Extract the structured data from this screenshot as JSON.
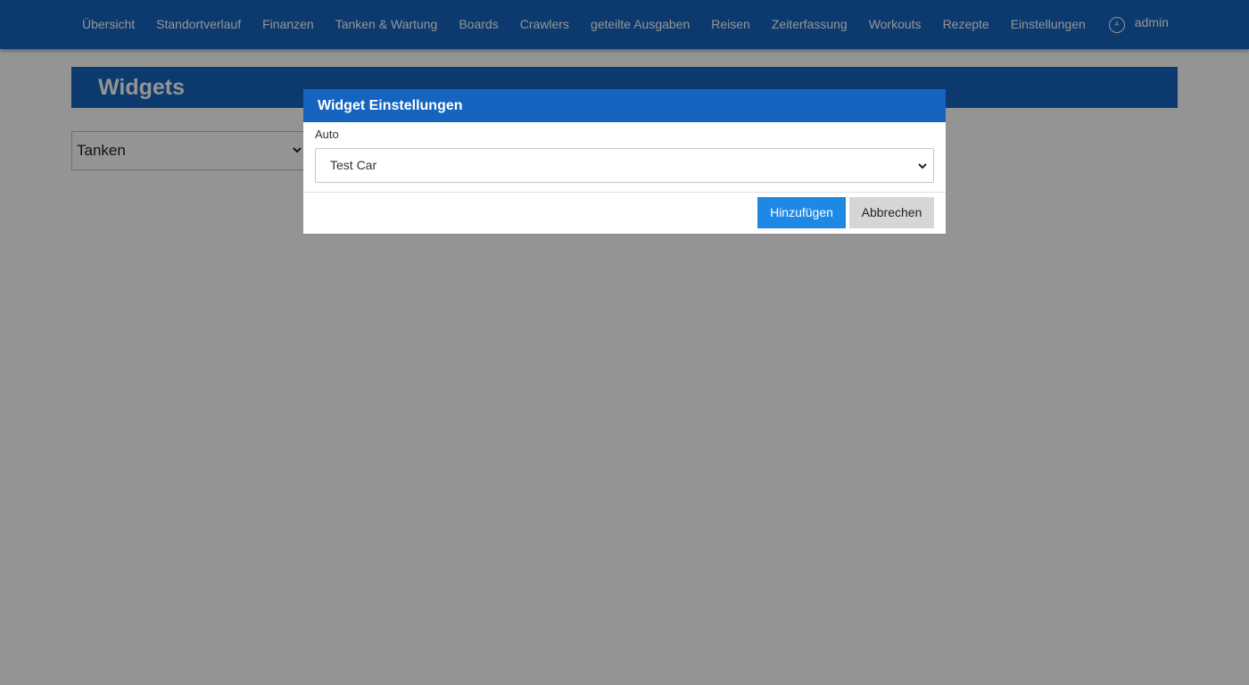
{
  "nav": {
    "items": [
      "Übersicht",
      "Standortverlauf",
      "Finanzen",
      "Tanken & Wartung",
      "Boards",
      "Crawlers",
      "geteilte Ausgaben",
      "Reisen",
      "Zeiterfassung",
      "Workouts",
      "Rezepte",
      "Einstellungen"
    ],
    "user": {
      "avatar_letter": "A",
      "name": "admin",
      "icon": "user-avatar-icon"
    }
  },
  "page": {
    "title": "Widgets",
    "widget_type_select": {
      "value": "Tanken",
      "icon": "chevron-down-icon"
    }
  },
  "modal": {
    "title": "Widget Einstellungen",
    "field_label": "Auto",
    "car_select_value": "Test Car",
    "add_button": "Hinzufügen",
    "cancel_button": "Abbrechen"
  },
  "colors": {
    "primary": "#1565c0",
    "button_primary": "#1e88e5",
    "button_secondary": "#d6d6d6",
    "overlay": "rgba(0,0,0,0.42)"
  }
}
